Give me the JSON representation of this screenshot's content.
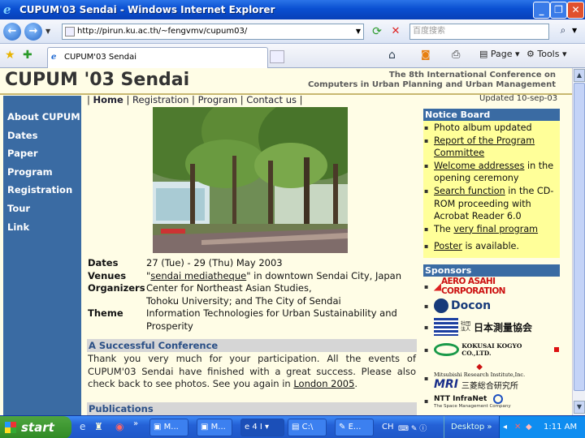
{
  "window": {
    "title": "CUPUM'03 Sendai - Windows Internet Explorer"
  },
  "address": {
    "url": "http://pirun.ku.ac.th/~fengvmv/cupum03/",
    "search_placeholder": "百度搜索"
  },
  "toolbar": {
    "tab_title": "CUPUM'03 Sendai",
    "page_label": "Page",
    "tools_label": "Tools"
  },
  "site": {
    "title": "CUPUM '03 Sendai",
    "conference_line1": "The 8th International Conference on",
    "conference_line2": "Computers in Urban Planning and Urban Management",
    "updated": "Updated 10-sep-03"
  },
  "sidebar": {
    "items": [
      {
        "label": "About CUPUM"
      },
      {
        "label": "Dates"
      },
      {
        "label": "Paper"
      },
      {
        "label": "Program"
      },
      {
        "label": "Registration"
      },
      {
        "label": "Tour"
      },
      {
        "label": "Link"
      }
    ]
  },
  "topmenu": {
    "sep": "|",
    "home": "Home",
    "registration": "Registration",
    "program": "Program",
    "contact": "Contact us"
  },
  "details": {
    "dates_label": "Dates",
    "dates_value": "27 (Tue) - 29 (Thu) May 2003",
    "venues_label": "Venues",
    "venues_q1": "\"",
    "venues_link": "sendai mediatheque",
    "venues_rest": "\" in downtown Sendai City, Japan",
    "org_label": "Organizers",
    "org_line1": "Center for Northeast Asian Studies,",
    "org_line2": "Tohoku University; and The City of Sendai",
    "theme_label": "Theme",
    "theme_value": "Information Technologies for Urban Sustainability and Prosperity"
  },
  "success": {
    "heading": "A Successful Conference",
    "text": "Thank you very much for your participation. All the events of CUPUM'03 Sendai have finished with a great success. Please also check back to see photos. See you again in ",
    "link": "London 2005",
    "end": "."
  },
  "publications": {
    "heading": "Publications"
  },
  "notice": {
    "heading": "Notice Board",
    "item1": "Photo album updated",
    "item2_link": "Report of the Program Committee",
    "item3_link": "Welcome addresses",
    "item3_rest": " in the opening ceremony",
    "item4_link": "Search function",
    "item4_rest": " in the CD-ROM proceeding with Acrobat Reader 6.0",
    "item5_pre": "The ",
    "item5_link": "very final program",
    "item6_link": "Poster",
    "item6_rest": " is available."
  },
  "sponsors": {
    "heading": "Sponsors",
    "aero": "AERO ASAHI CORPORATION",
    "docon": "Docon",
    "survey": "日本測量協会",
    "survey_small": "社団法人",
    "kokusai": "KOKUSAI KOGYO CO.,LTD.",
    "mri_top": "Mitsubishi Research Institute,Inc.",
    "mri": "MRI",
    "mri_jp": "三菱総合研究所",
    "ntt": "NTT InfraNet",
    "space": "The Space Management Company"
  },
  "taskbar": {
    "start": "start",
    "btn1": "M...",
    "btn2": "M...",
    "btn3": "4 I",
    "btn4": "C:\\",
    "btn5": "E...",
    "lang": "CH",
    "desktop": "Desktop",
    "time": "1:11 AM"
  },
  "colors": {
    "sidebar": "#3a6ba3",
    "page_bg": "#fffde6",
    "notice_bg": "#ffff99",
    "title_bar": "#0a4fd1"
  }
}
